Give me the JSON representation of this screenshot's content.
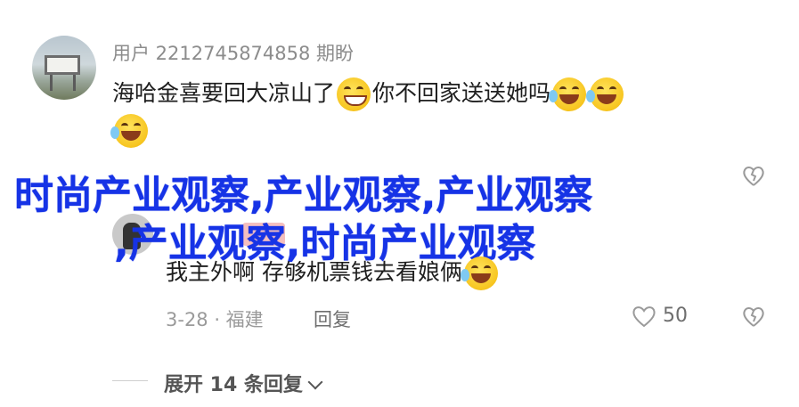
{
  "comment1": {
    "username": "用户 2212745874858 期盼",
    "text": "海哈金喜要回大凉山了",
    "text2": "你不回家送送她吗"
  },
  "overlay": {
    "line1": "时尚产业观察,产业观察,产业观察",
    "line2": ",产业观察,时尚产业观察"
  },
  "comment2": {
    "text": "我主外啊 存够机票钱去看娘俩",
    "date_location": "3-28 · 福建",
    "reply_label": "回复",
    "like_count": "50"
  },
  "replies": {
    "expand_label": "展开 14 条回复"
  },
  "icons": {
    "like": "heart-outline-icon",
    "dislike": "broken-heart-icon",
    "emoji_laugh": "laughing-tears-emoji",
    "emoji_grin": "grin-emoji"
  },
  "colors": {
    "overlay_text": "#1633e6",
    "muted_text": "#9a9a9a"
  }
}
